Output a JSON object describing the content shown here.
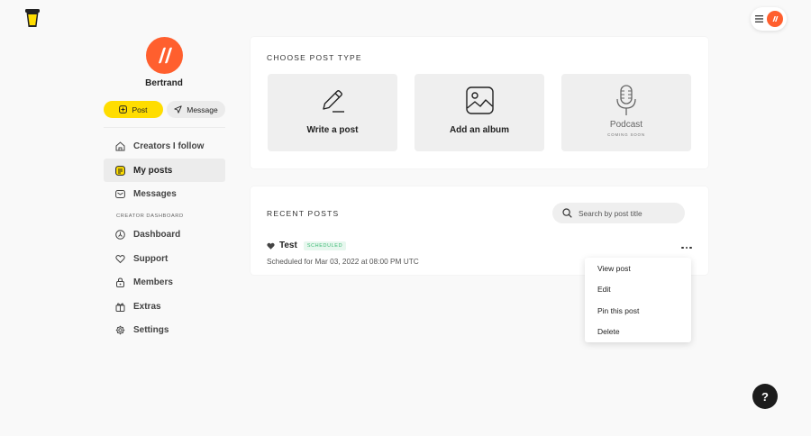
{
  "profile": {
    "name": "Bertrand"
  },
  "actions": {
    "post_label": "Post",
    "message_label": "Message"
  },
  "sidebar": {
    "items": [
      {
        "label": "Creators I follow",
        "icon": "home-icon"
      },
      {
        "label": "My posts",
        "icon": "posts-icon",
        "active": true
      },
      {
        "label": "Messages",
        "icon": "mail-icon"
      }
    ],
    "section_label": "CREATOR DASHBOARD",
    "creator_items": [
      {
        "label": "Dashboard",
        "icon": "dashboard-icon"
      },
      {
        "label": "Support",
        "icon": "heart-icon"
      },
      {
        "label": "Members",
        "icon": "lock-icon"
      },
      {
        "label": "Extras",
        "icon": "gift-icon"
      },
      {
        "label": "Settings",
        "icon": "gear-icon"
      }
    ]
  },
  "post_type": {
    "title": "CHOOSE POST TYPE",
    "options": [
      {
        "label": "Write a post",
        "icon": "pencil-icon"
      },
      {
        "label": "Add an album",
        "icon": "image-icon"
      },
      {
        "label": "Podcast",
        "sublabel": "COMING SOON",
        "icon": "microphone-icon"
      }
    ]
  },
  "recent": {
    "title": "RECENT POSTS",
    "search_placeholder": "Search by post title",
    "posts": [
      {
        "title": "Test",
        "status": "SCHEDULED",
        "meta": "Scheduled for Mar 03, 2022 at 08:00 PM UTC"
      }
    ]
  },
  "post_menu": {
    "items": [
      "View post",
      "Edit",
      "Pin this post",
      "Delete"
    ]
  },
  "help": {
    "label": "?"
  },
  "colors": {
    "accent": "#ffdd00",
    "avatar": "#ff5f2e",
    "scheduled": "#3cba74"
  }
}
